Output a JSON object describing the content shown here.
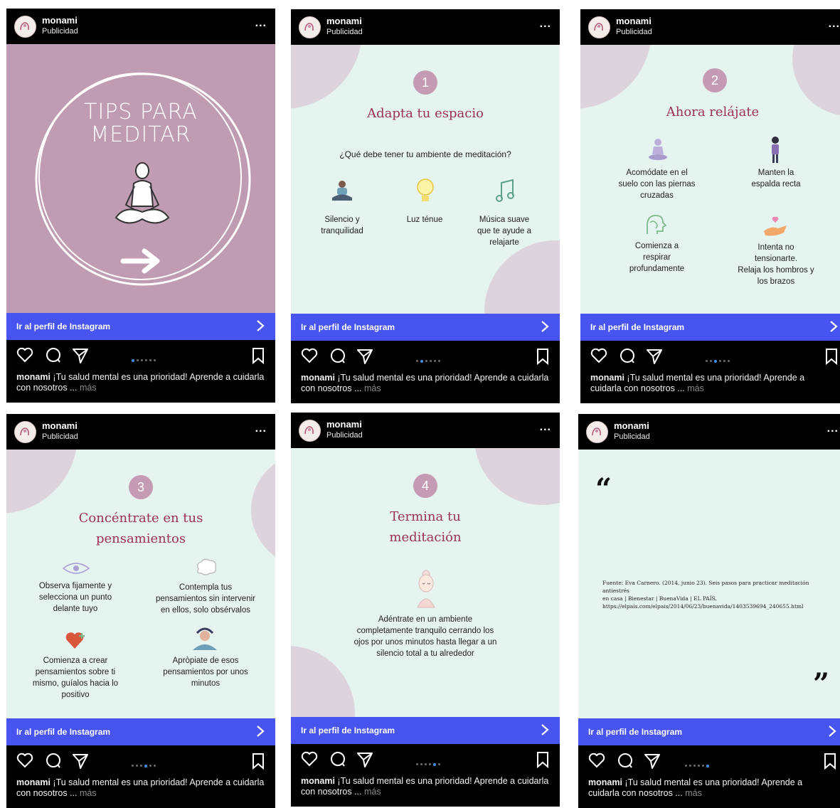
{
  "common": {
    "username": "monami",
    "sponsored": "Publicidad",
    "menu_dots": "...",
    "cta_label": "Ir al perfil de Instagram",
    "caption_user": "monami",
    "caption_text": "¡Tu salud mental es una prioridad! Aprende a cuidarla con nosotros ...",
    "caption_more": "más"
  },
  "colors": {
    "cta": "#4754ef",
    "slide_bg_mint": "#e6f4f0",
    "slide_bg_mauve": "#c09cb3",
    "title_text": "#9b3056",
    "number_badge": "#c59ab3",
    "pager_active": "#3f8ef0"
  },
  "icons": [
    "heart-icon",
    "comment-icon",
    "send-icon",
    "bookmark-icon",
    "chevron-right-icon",
    "more-icon"
  ],
  "posts": [
    {
      "pager_active": 1,
      "title_line1": "TIPS PARA",
      "title_line2": "MEDITAR"
    },
    {
      "pager_active": 2,
      "number": "1",
      "title": "Adapta tu espacio",
      "question": "¿Qué debe tener tu ambiente de meditación?",
      "items": [
        {
          "line1": "Silencio y",
          "line2": "tranquilidad",
          "line3": ""
        },
        {
          "line1": "Luz ténue",
          "line2": "",
          "line3": ""
        },
        {
          "line1": "Música suave",
          "line2": "que te ayude a",
          "line3": "relajarte"
        }
      ]
    },
    {
      "pager_active": 3,
      "number": "2",
      "title": "Ahora relájate",
      "items": [
        {
          "line1": "Acomódate en el",
          "line2": "suelo con las piernas",
          "line3": "cruzadas",
          "line4": ""
        },
        {
          "line1": "Manten la",
          "line2": "espalda recta",
          "line3": "",
          "line4": ""
        },
        {
          "line1": "Comienza a",
          "line2": "respirar",
          "line3": "profundamente",
          "line4": ""
        },
        {
          "line1": "Intenta no",
          "line2": "tensionarte.",
          "line3": "Relaja los hombros y",
          "line4": "los brazos"
        }
      ]
    },
    {
      "pager_active": 4,
      "number": "3",
      "title_line1": "Concéntrate en tus",
      "title_line2": "pensamientos",
      "items": [
        {
          "line1": "Observa fijamente y",
          "line2": "selecciona un punto",
          "line3": "delante tuyo",
          "line4": ""
        },
        {
          "line1": "Contempla tus",
          "line2": "pensamientos sin intervenir",
          "line3": "en ellos, solo obsérvalos",
          "line4": ""
        },
        {
          "line1": "Comienza a crear",
          "line2": "pensamientos sobre ti",
          "line3": "mismo, guíalos hacia lo",
          "line4": "positivo"
        },
        {
          "line1": "Apròpiate de esos",
          "line2": "pensamientos por unos",
          "line3": "minutos",
          "line4": ""
        }
      ]
    },
    {
      "pager_active": 5,
      "number": "4",
      "title_line1": "Termina tu",
      "title_line2": "meditación",
      "text_line1": "Adéntrate en un ambiente",
      "text_line2": "completamente tranquilo cerrando los",
      "text_line3": "ojos por unos minutos hasta llegar a un",
      "text_line4": "silencio total a tu alrededor"
    },
    {
      "pager_active": 6,
      "quote_open": "“",
      "quote_close": "”",
      "source_line1": "Fuente: Eva Carnero. (2014, junio 23). Seis pasos para practicar meditación antiestrés",
      "source_line2": "en casa | Bienestar | BuenaVida | EL PAÍS.",
      "source_line3": "https://elpais.com/elpais/2014/06/23/buenavida/1403539694_240655.html"
    }
  ]
}
